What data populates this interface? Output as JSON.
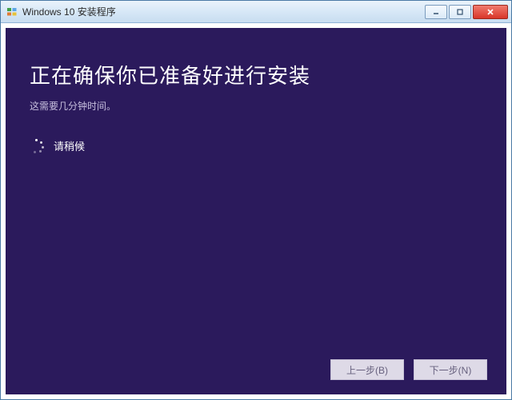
{
  "window": {
    "title": "Windows 10 安装程序"
  },
  "content": {
    "heading": "正在确保你已准备好进行安装",
    "subtext": "这需要几分钟时间。",
    "wait_label": "请稍候"
  },
  "buttons": {
    "back": "上一步(B)",
    "next": "下一步(N)"
  }
}
